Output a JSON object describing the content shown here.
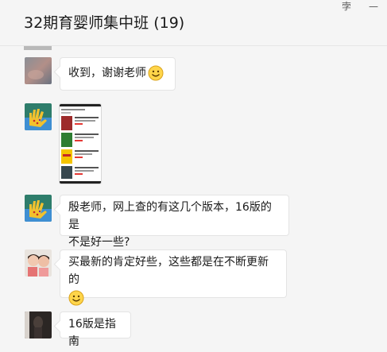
{
  "window": {
    "title": "32期育婴师集中班 (19)",
    "pin_glyph": "孛",
    "close_glyph": "—"
  },
  "messages": [
    {
      "sender_avatar": "avatar-blurred",
      "type": "text",
      "text": "收到，谢谢老师",
      "emoji": "smile-emoji"
    },
    {
      "sender_avatar": "avatar-handprint",
      "type": "image",
      "alt": "screenshot-image"
    },
    {
      "sender_avatar": "avatar-handprint",
      "type": "text",
      "text_line1": "殷老师，网上查的有这几个版本，16版的是",
      "text_line2": "不是好一些?"
    },
    {
      "sender_avatar": "avatar-kids",
      "type": "text",
      "text": "买最新的肯定好些，这些都是在不断更新的",
      "emoji": "smile-emoji"
    },
    {
      "sender_avatar": "avatar-dark",
      "type": "text",
      "text": "16版是指南"
    }
  ],
  "colors": {
    "background": "#f5f5f5",
    "bubble": "#ffffff",
    "bubble_border": "#e4e4e4"
  }
}
